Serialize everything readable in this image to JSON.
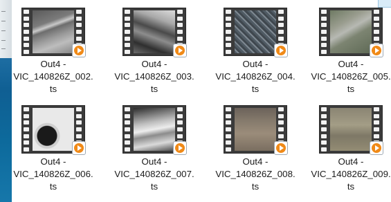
{
  "files": [
    {
      "name_line1": "Out4 -",
      "name_line2": "VIC_140826Z_002.",
      "name_line3": "ts",
      "icon": "video-file-icon",
      "thumb": "runway"
    },
    {
      "name_line1": "Out4 -",
      "name_line2": "VIC_140826Z_003.",
      "name_line3": "ts",
      "icon": "video-file-icon",
      "thumb": "bw-aerial"
    },
    {
      "name_line1": "Out4 -",
      "name_line2": "VIC_140826Z_004.",
      "name_line3": "ts",
      "icon": "video-file-icon",
      "thumb": "city"
    },
    {
      "name_line1": "Out4 -",
      "name_line2": "VIC_140826Z_005.",
      "name_line3": "ts",
      "icon": "video-file-icon",
      "thumb": "airfield"
    },
    {
      "name_line1": "Out4 -",
      "name_line2": "VIC_140826Z_006.",
      "name_line3": "ts",
      "icon": "video-file-icon",
      "thumb": "wing"
    },
    {
      "name_line1": "Out4 -",
      "name_line2": "VIC_140826Z_007.",
      "name_line3": "ts",
      "icon": "video-file-icon",
      "thumb": "bw-fields"
    },
    {
      "name_line1": "Out4 -",
      "name_line2": "VIC_140826Z_008.",
      "name_line3": "ts",
      "icon": "video-file-icon",
      "thumb": "brown-terrain"
    },
    {
      "name_line1": "Out4 -",
      "name_line2": "VIC_140826Z_009.",
      "name_line3": "ts",
      "icon": "video-file-icon",
      "thumb": "plain"
    }
  ],
  "colors": {
    "play_badge": "#f08a18",
    "desktop_blue": "#0f5f93"
  }
}
